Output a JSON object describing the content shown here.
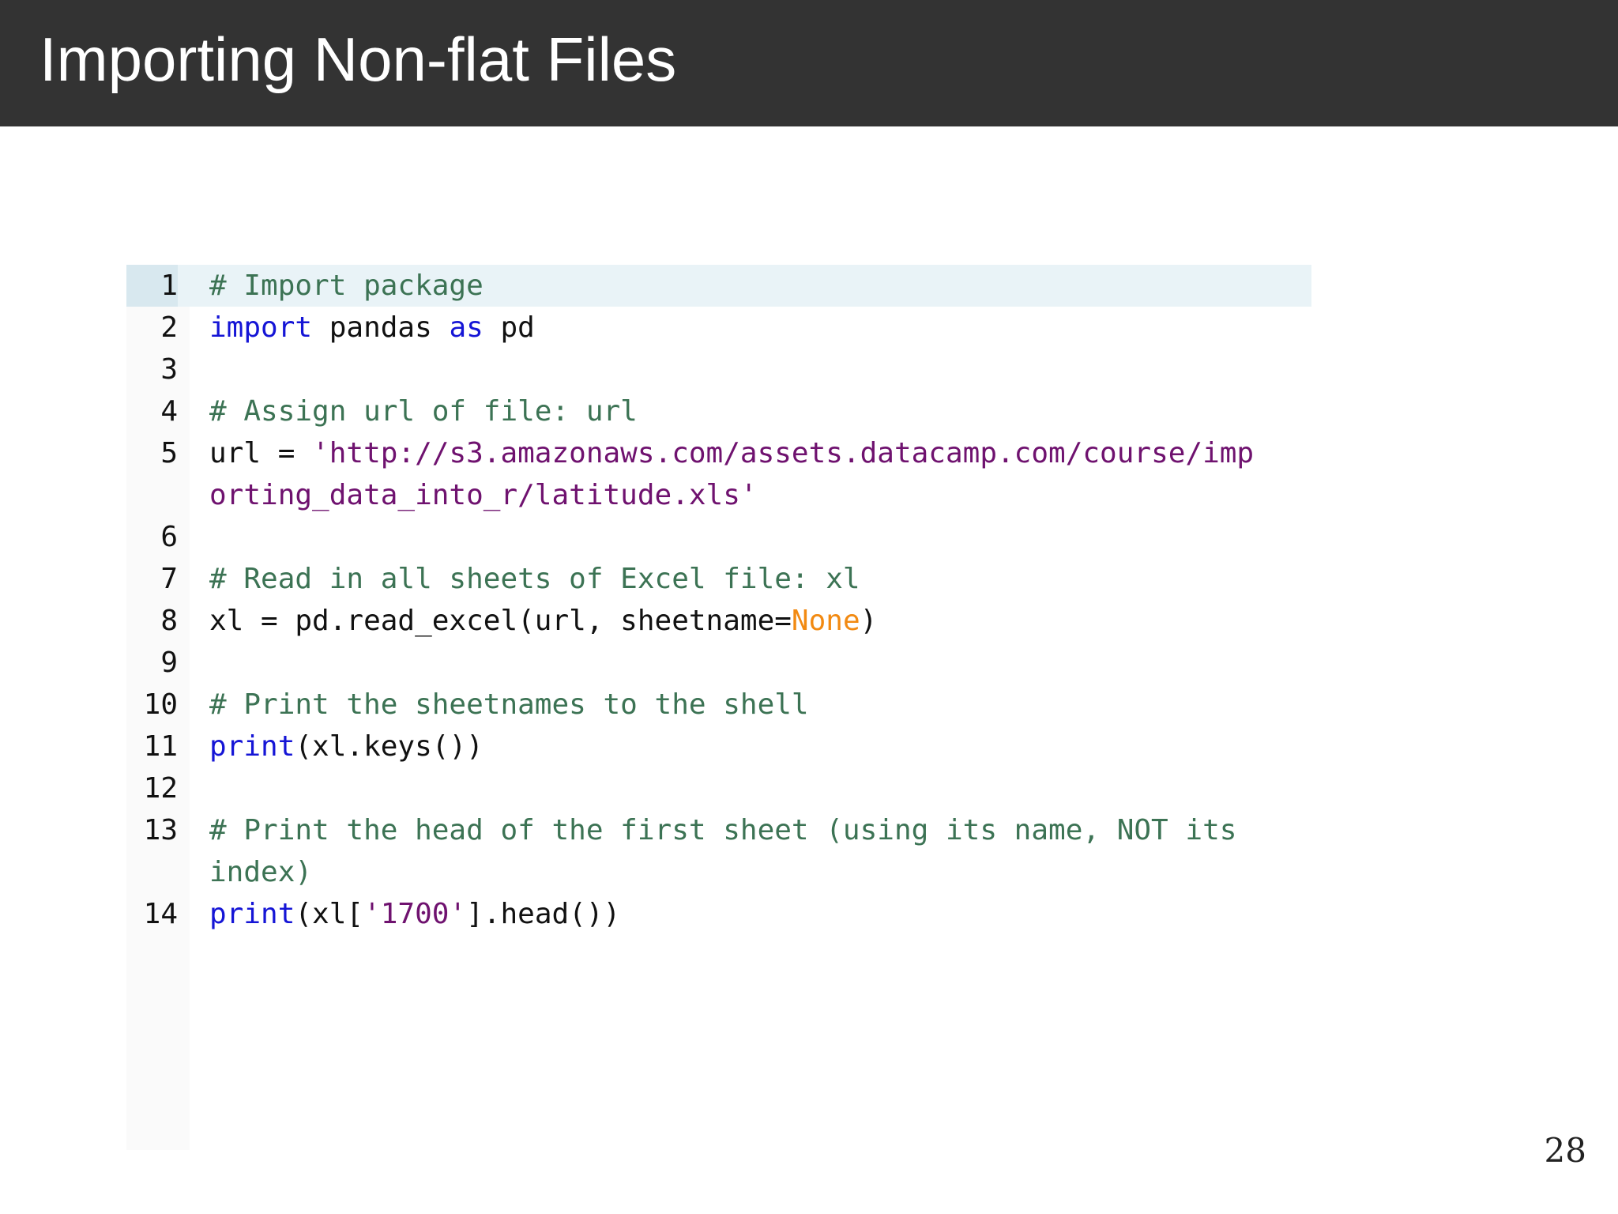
{
  "slide": {
    "title": "Importing Non-flat Files",
    "page_number": "28"
  },
  "code": {
    "active_line": 1,
    "colors": {
      "comment": "#3c7354",
      "keyword": "#1515d6",
      "string": "#6f126f",
      "constant": "#f28a12",
      "plain": "#111111",
      "active_line_bg": "#e9f3f7"
    },
    "lines": [
      {
        "number": "1",
        "tokens": [
          {
            "t": "comment",
            "v": "# Import package"
          }
        ]
      },
      {
        "number": "2",
        "tokens": [
          {
            "t": "keyword",
            "v": "import"
          },
          {
            "t": "plain",
            "v": " pandas "
          },
          {
            "t": "keyword",
            "v": "as"
          },
          {
            "t": "plain",
            "v": " pd"
          }
        ]
      },
      {
        "number": "3",
        "tokens": []
      },
      {
        "number": "4",
        "tokens": [
          {
            "t": "comment",
            "v": "# Assign url of file: url"
          }
        ]
      },
      {
        "number": "5",
        "tokens": [
          {
            "t": "plain",
            "v": "url = "
          },
          {
            "t": "string",
            "v": "'http://s3.amazonaws.com/assets.datacamp.com/course/importing_data_into_r/latitude.xls'"
          }
        ]
      },
      {
        "number": "6",
        "tokens": []
      },
      {
        "number": "7",
        "tokens": [
          {
            "t": "comment",
            "v": "# Read in all sheets of Excel file: xl"
          }
        ]
      },
      {
        "number": "8",
        "tokens": [
          {
            "t": "plain",
            "v": "xl = pd.read_excel(url, sheetname="
          },
          {
            "t": "constant",
            "v": "None"
          },
          {
            "t": "plain",
            "v": ")"
          }
        ]
      },
      {
        "number": "9",
        "tokens": []
      },
      {
        "number": "10",
        "tokens": [
          {
            "t": "comment",
            "v": "# Print the sheetnames to the shell"
          }
        ]
      },
      {
        "number": "11",
        "tokens": [
          {
            "t": "keyword",
            "v": "print"
          },
          {
            "t": "plain",
            "v": "(xl.keys())"
          }
        ]
      },
      {
        "number": "12",
        "tokens": []
      },
      {
        "number": "13",
        "tokens": [
          {
            "t": "comment",
            "v": "# Print the head of the first sheet (using its name, NOT its index)"
          }
        ]
      },
      {
        "number": "14",
        "tokens": [
          {
            "t": "keyword",
            "v": "print"
          },
          {
            "t": "plain",
            "v": "(xl["
          },
          {
            "t": "string",
            "v": "'1700'"
          },
          {
            "t": "plain",
            "v": "].head())"
          }
        ]
      }
    ]
  }
}
